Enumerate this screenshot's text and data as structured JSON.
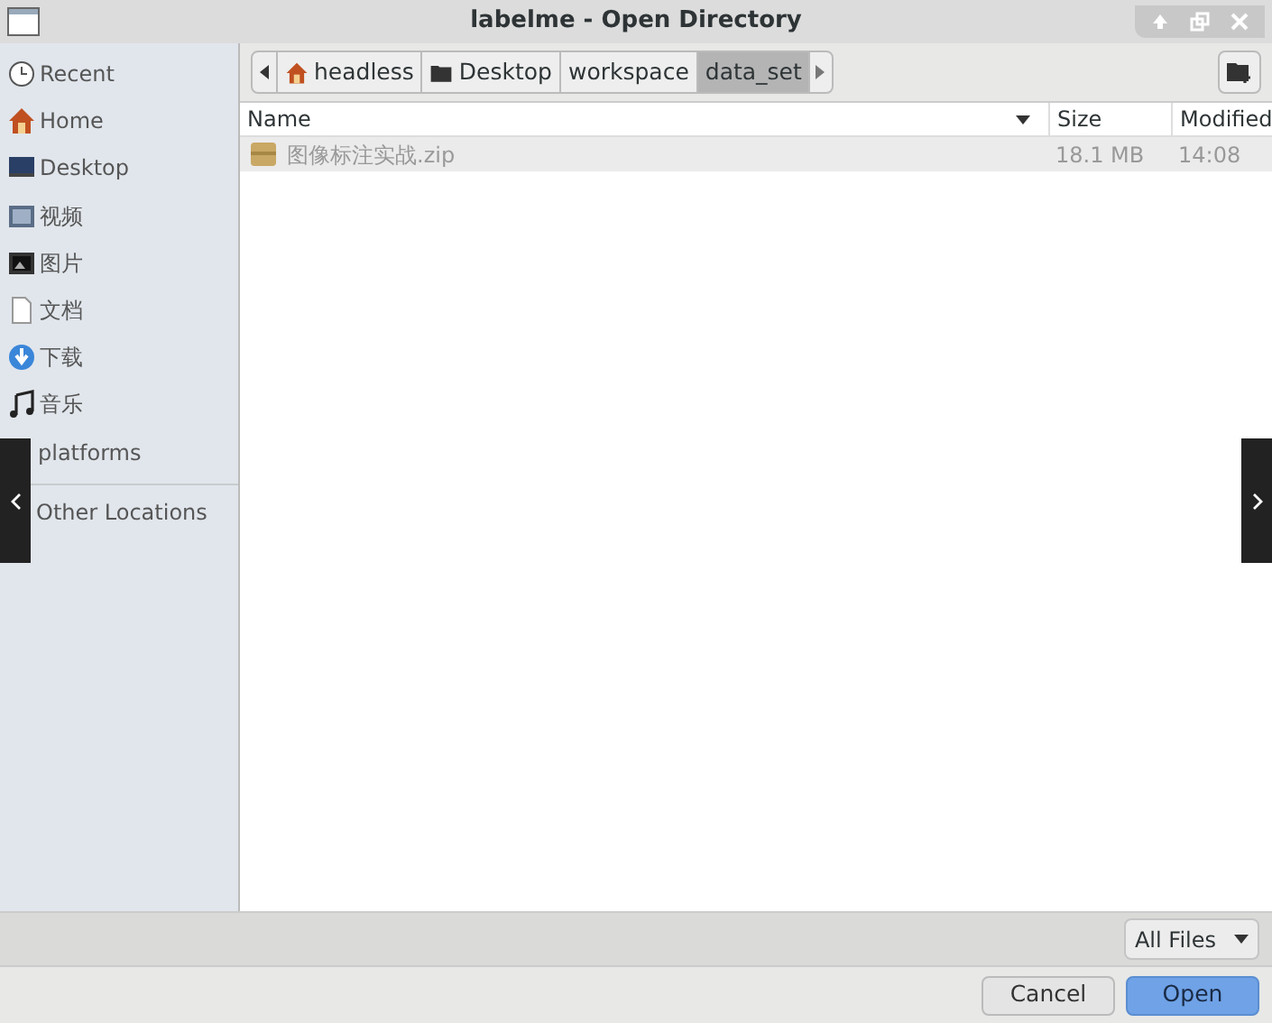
{
  "window": {
    "title": "labelme - Open Directory"
  },
  "sidebar": {
    "items": [
      {
        "label": "Recent",
        "kind": "clock",
        "selected": false
      },
      {
        "label": "Home",
        "kind": "home",
        "selected": false
      },
      {
        "label": "Desktop",
        "kind": "desktop",
        "selected": false
      },
      {
        "label": "视频",
        "kind": "video",
        "selected": false
      },
      {
        "label": "图片",
        "kind": "picture",
        "selected": false
      },
      {
        "label": "文档",
        "kind": "document",
        "selected": false
      },
      {
        "label": "下载",
        "kind": "download",
        "selected": false
      },
      {
        "label": "音乐",
        "kind": "music",
        "selected": false
      },
      {
        "label": "platforms",
        "selected": false
      }
    ],
    "other": {
      "label": "Other Locations"
    }
  },
  "path_bar": [
    {
      "label": "headless",
      "kind": "home",
      "selected": false
    },
    {
      "label": "Desktop",
      "kind": "folder",
      "selected": false
    },
    {
      "label": "workspace",
      "kind": "plain",
      "selected": false
    },
    {
      "label": "data_set",
      "kind": "plain",
      "selected": true
    }
  ],
  "table": {
    "columns": [
      "Name",
      "Size",
      "Modified"
    ],
    "rows": [
      {
        "name": "图像标注实战.zip",
        "size": "18.1 MB",
        "modified": "14:08",
        "selected": true
      }
    ]
  },
  "filter": {
    "value": "All Files"
  },
  "buttons": [
    {
      "label": "Cancel",
      "kind": "secondary"
    },
    {
      "label": "Open",
      "kind": "primary"
    }
  ]
}
